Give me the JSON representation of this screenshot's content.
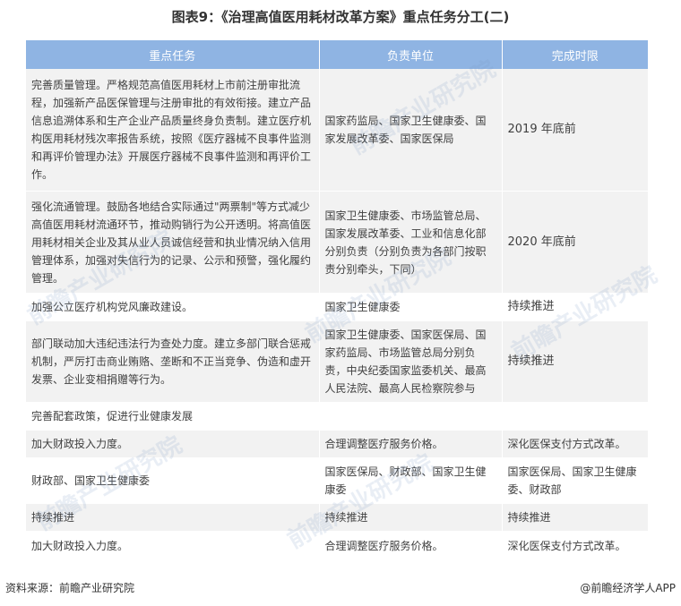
{
  "title": "图表9：《治理高值医用耗材改革方案》重点任务分工(二)",
  "table": {
    "headers": [
      "重点任务",
      "负责单位",
      "完成时限"
    ],
    "rows": [
      [
        "完善质量管理。严格规范高值医用耗材上市前注册审批流程，加强新产品医保管理与注册审批的有效衔接。建立产品信息追溯体系和生产企业产品质量终身负责制。建立医疗机构医用耗材残次率报告系统，按照《医疗器械不良事件监测和再评价管理办法》开展医疗器械不良事件监测和再评价工作。",
        "国家药监局、国家卫生健康委、国家发展改革委、国家医保局",
        "2019 年底前"
      ],
      [
        "强化流通管理。鼓励各地结合实际通过\"两票制\"等方式减少高值医用耗材流通环节，推动购销行为公开透明。将高值医用耗材相关企业及其从业人员诚信经营和执业情况纳入信用管理体系，加强对失信行为的记录、公示和预警，强化履约管理。",
        "国家卫生健康委、市场监管总局、国家发展改革委、工业和信息化部分别负责（分别负责为各部门按职责分别牵头，下同）",
        "2020 年底前"
      ],
      [
        "加强公立医疗机构党风廉政建设。",
        "国家卫生健康委",
        "持续推进"
      ],
      [
        "部门联动加大违纪违法行为查处力度。建立多部门联合惩戒机制，严厉打击商业贿赂、垄断和不正当竞争、伪造和虚开发票、企业变相捐赠等行为。",
        "国家卫生健康委、国家医保局、国家药监局、市场监管总局分别负责，中央纪委国家监委机关、最高人民法院、最高人民检察院参与",
        "持续推进"
      ]
    ],
    "section_row": "完善配套政策，促进行业健康发展",
    "rows_after": [
      [
        "加大财政投入力度。",
        "合理调整医疗服务价格。",
        "深化医保支付方式改革。"
      ],
      [
        "财政部、国家卫生健康委",
        "国家医保局、财政部、国家卫生健康委",
        "国家医保局、国家卫生健康委、财政部"
      ],
      [
        "持续推进",
        "持续推进",
        "持续推进"
      ],
      [
        "加大财政投入力度。",
        "合理调整医疗服务价格。",
        "深化医保支付方式改革。"
      ]
    ]
  },
  "footer": {
    "source": "资料来源：前瞻产业研究院",
    "brand": "@前瞻经济学人APP"
  },
  "watermark_text": "前瞻产业研究院"
}
